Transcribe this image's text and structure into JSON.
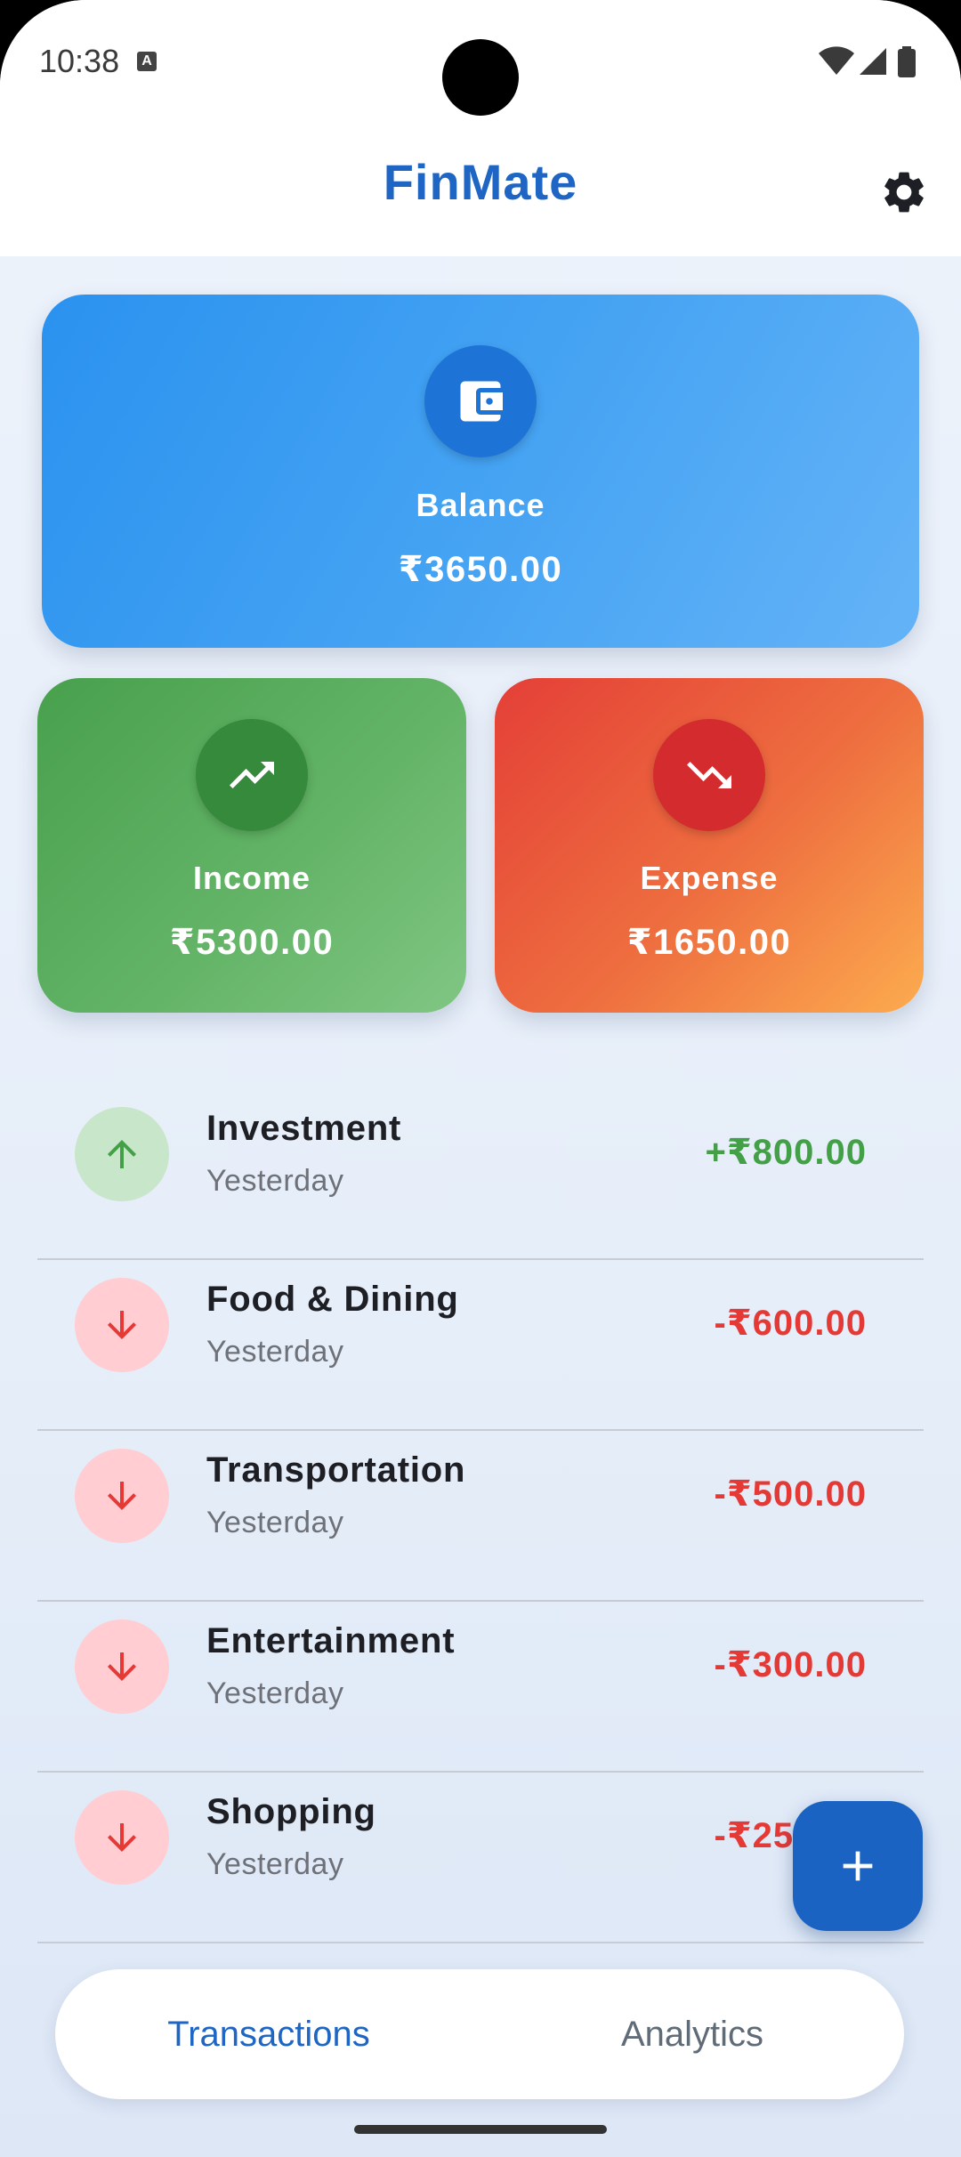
{
  "status_bar": {
    "time": "10:38",
    "notification_icon": "text-a-icon",
    "icons": [
      "wifi-icon",
      "signal-icon",
      "battery-icon"
    ]
  },
  "app_bar": {
    "title": "FinMate",
    "settings_icon": "gear-icon"
  },
  "summary": {
    "balance": {
      "label": "Balance",
      "value": "₹3650.00",
      "icon": "wallet-icon"
    },
    "income": {
      "label": "Income",
      "value": "₹5300.00",
      "icon": "trending-up-icon"
    },
    "expense": {
      "label": "Expense",
      "value": "₹1650.00",
      "icon": "trending-down-icon"
    }
  },
  "transactions": [
    {
      "category": "Investment",
      "date": "Yesterday",
      "amount": "+₹800.00",
      "type": "income"
    },
    {
      "category": "Food & Dining",
      "date": "Yesterday",
      "amount": "-₹600.00",
      "type": "expense"
    },
    {
      "category": "Transportation",
      "date": "Yesterday",
      "amount": "-₹500.00",
      "type": "expense"
    },
    {
      "category": "Entertainment",
      "date": "Yesterday",
      "amount": "-₹300.00",
      "type": "expense"
    },
    {
      "category": "Shopping",
      "date": "Yesterday",
      "amount": "-₹250.00",
      "type": "expense"
    }
  ],
  "fab": {
    "icon": "plus-icon"
  },
  "bottom_nav": {
    "items": [
      {
        "label": "Transactions",
        "active": true
      },
      {
        "label": "Analytics",
        "active": false
      }
    ]
  },
  "colors": {
    "primary": "#1e65c4",
    "income": "#43a047",
    "expense": "#e53935",
    "income_bg": "#c8e6c9",
    "expense_bg": "#ffcdd2"
  }
}
